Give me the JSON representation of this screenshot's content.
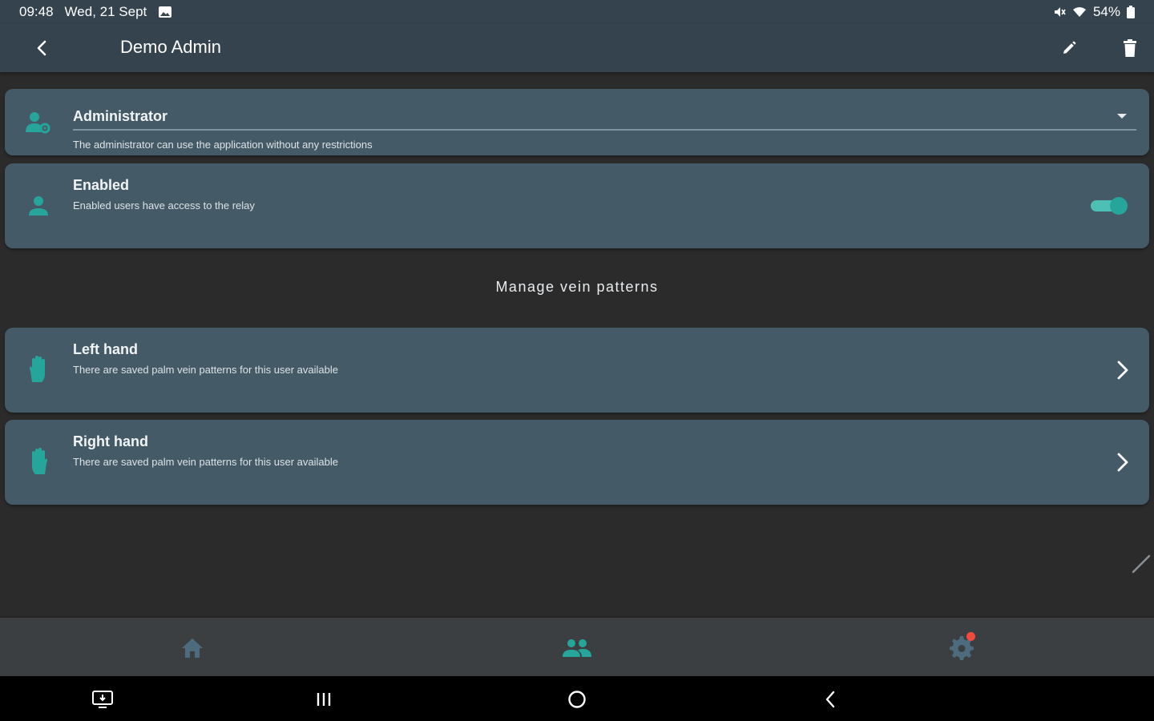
{
  "status_bar": {
    "time": "09:48",
    "date": "Wed, 21 Sept",
    "battery": "54%"
  },
  "app_bar": {
    "title": "Demo Admin"
  },
  "role": {
    "label": "Administrator",
    "description": "The administrator can use the application without any restrictions"
  },
  "enabled": {
    "label": "Enabled",
    "description": "Enabled users have access to the relay",
    "value": true
  },
  "section_title": "Manage vein patterns",
  "hands": [
    {
      "label": "Left hand",
      "description": "There are saved palm vein patterns for this user available"
    },
    {
      "label": "Right hand",
      "description": "There are saved palm vein patterns for this user available"
    }
  ],
  "bottom_nav": {
    "items": [
      "home-icon",
      "users-icon",
      "settings-icon"
    ],
    "active": "users-icon",
    "settings_badge": true
  },
  "colors": {
    "accent": "#26a69a",
    "card": "#455a67",
    "app_bar": "#34434d",
    "background": "#2b2b2b",
    "badge": "#f24a3d"
  }
}
